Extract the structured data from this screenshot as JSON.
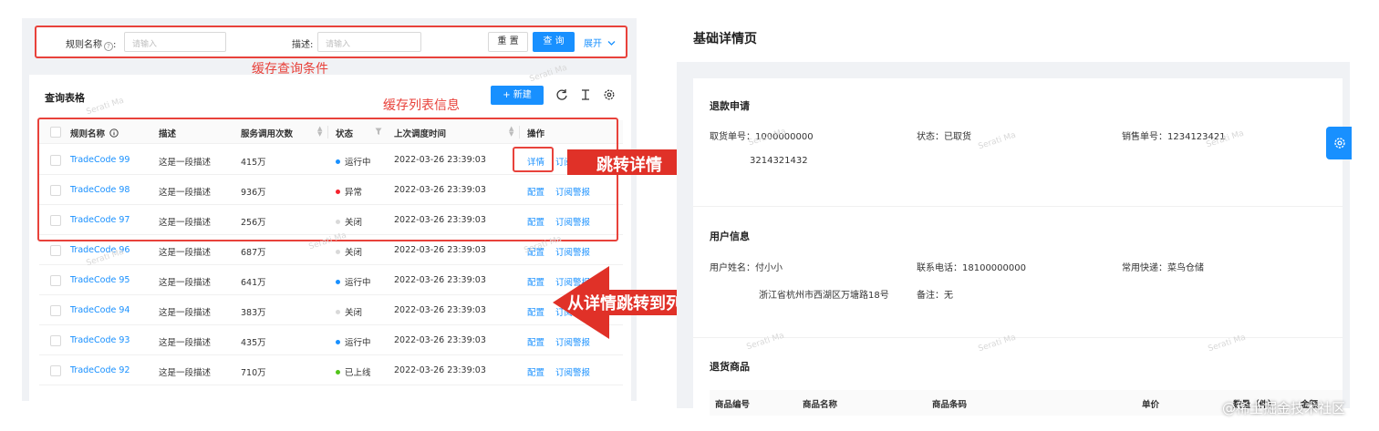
{
  "filter": {
    "rule_name_label": "规则名称",
    "rule_name_placeholder": "请输入",
    "desc_label": "描述:",
    "desc_placeholder": "请输入",
    "reset_label": "重 置",
    "query_label": "查 询",
    "expand_label": "展开"
  },
  "annotations": {
    "cache_query": "缓存查询条件",
    "cache_list": "缓存列表信息",
    "jump_detail": "跳转详情",
    "back_to_list": "从详情跳转到列表页"
  },
  "table": {
    "title": "查询表格",
    "new_label": "+ 新建",
    "headers": {
      "name": "规则名称",
      "desc": "描述",
      "calls": "服务调用次数",
      "status": "状态",
      "time": "上次调度时间",
      "ops": "操作"
    },
    "op_labels": {
      "config": "配置",
      "subscribe": "订阅警报",
      "detail": "详情"
    },
    "rows": [
      {
        "name": "TradeCode 99",
        "desc": "这是一段描述",
        "calls": "415万",
        "status": "运行中",
        "status_color": "#1890ff",
        "time": "2022-03-26 23:39:03",
        "op1": "详情",
        "op2": "订阅"
      },
      {
        "name": "TradeCode 98",
        "desc": "这是一段描述",
        "calls": "936万",
        "status": "异常",
        "status_color": "#f5222d",
        "time": "2022-03-26 23:39:03",
        "op1": "配置",
        "op2": "订阅警报"
      },
      {
        "name": "TradeCode 97",
        "desc": "这是一段描述",
        "calls": "256万",
        "status": "关闭",
        "status_color": "#d9d9d9",
        "time": "2022-03-26 23:39:03",
        "op1": "配置",
        "op2": "订阅警报"
      },
      {
        "name": "TradeCode 96",
        "desc": "这是一段描述",
        "calls": "687万",
        "status": "关闭",
        "status_color": "#d9d9d9",
        "time": "2022-03-26 23:39:03",
        "op1": "配置",
        "op2": "订阅警报"
      },
      {
        "name": "TradeCode 95",
        "desc": "这是一段描述",
        "calls": "641万",
        "status": "运行中",
        "status_color": "#1890ff",
        "time": "2022-03-26 23:39:03",
        "op1": "配置",
        "op2": "订阅警报"
      },
      {
        "name": "TradeCode 94",
        "desc": "这是一段描述",
        "calls": "383万",
        "status": "关闭",
        "status_color": "#d9d9d9",
        "time": "2022-03-26 23:39:03",
        "op1": "配置",
        "op2": "订阅"
      },
      {
        "name": "TradeCode 93",
        "desc": "这是一段描述",
        "calls": "435万",
        "status": "运行中",
        "status_color": "#1890ff",
        "time": "2022-03-26 23:39:03",
        "op1": "配置",
        "op2": "订阅警报"
      },
      {
        "name": "TradeCode 92",
        "desc": "这是一段描述",
        "calls": "710万",
        "status": "已上线",
        "status_color": "#52c41a",
        "time": "2022-03-26 23:39:03",
        "op1": "配置",
        "op2": "订阅警报"
      }
    ]
  },
  "detail": {
    "page_title": "基础详情页",
    "refund_section": "退款申请",
    "pickup_no": "取货单号：1000000000",
    "status": "状态：已取货",
    "sales_no": "销售单号：1234123421",
    "sub_order_tail": "3214321432",
    "user_section": "用户信息",
    "user_name": "用户姓名：付小小",
    "phone": "联系电话：18100000000",
    "express": "常用快递：菜鸟仓储",
    "address_value": "浙江省杭州市西湖区万塘路18号",
    "remark": "备注：无",
    "goods_section": "退货商品",
    "goods_headers": [
      "商品编号",
      "商品名称",
      "商品条码",
      "单价",
      "数量（件）",
      "金额"
    ]
  },
  "watermark_text": "Serati Ma",
  "footer_mark": "@稀土掘金技术社区",
  "colors": {
    "primary": "#1890ff",
    "annotation_red": "#e8423b",
    "arrow_red": "#e03128"
  },
  "icons": [
    "help-icon",
    "chevron-down-icon",
    "reload-icon",
    "column-height-icon",
    "setting-icon",
    "info-icon",
    "sort-icon",
    "filter-icon"
  ]
}
